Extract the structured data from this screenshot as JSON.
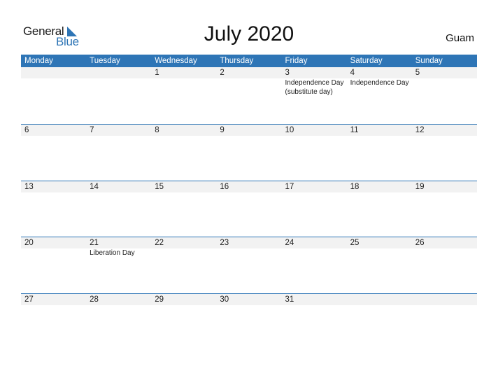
{
  "logo": {
    "word1": "General",
    "word2": "Blue"
  },
  "title": "July 2020",
  "country": "Guam",
  "colors": {
    "accent": "#2e75b6",
    "band": "#f2f2f2"
  },
  "weekdays": [
    "Monday",
    "Tuesday",
    "Wednesday",
    "Thursday",
    "Friday",
    "Saturday",
    "Sunday"
  ],
  "weeks": [
    [
      {
        "day": ""
      },
      {
        "day": ""
      },
      {
        "day": "1"
      },
      {
        "day": "2"
      },
      {
        "day": "3",
        "holiday": "Independence Day (substitute day)"
      },
      {
        "day": "4",
        "holiday": "Independence Day"
      },
      {
        "day": "5"
      }
    ],
    [
      {
        "day": "6"
      },
      {
        "day": "7"
      },
      {
        "day": "8"
      },
      {
        "day": "9"
      },
      {
        "day": "10"
      },
      {
        "day": "11"
      },
      {
        "day": "12"
      }
    ],
    [
      {
        "day": "13"
      },
      {
        "day": "14"
      },
      {
        "day": "15"
      },
      {
        "day": "16"
      },
      {
        "day": "17"
      },
      {
        "day": "18"
      },
      {
        "day": "19"
      }
    ],
    [
      {
        "day": "20"
      },
      {
        "day": "21",
        "holiday": "Liberation Day"
      },
      {
        "day": "22"
      },
      {
        "day": "23"
      },
      {
        "day": "24"
      },
      {
        "day": "25"
      },
      {
        "day": "26"
      }
    ],
    [
      {
        "day": "27"
      },
      {
        "day": "28"
      },
      {
        "day": "29"
      },
      {
        "day": "30"
      },
      {
        "day": "31"
      },
      {
        "day": ""
      },
      {
        "day": ""
      }
    ]
  ]
}
